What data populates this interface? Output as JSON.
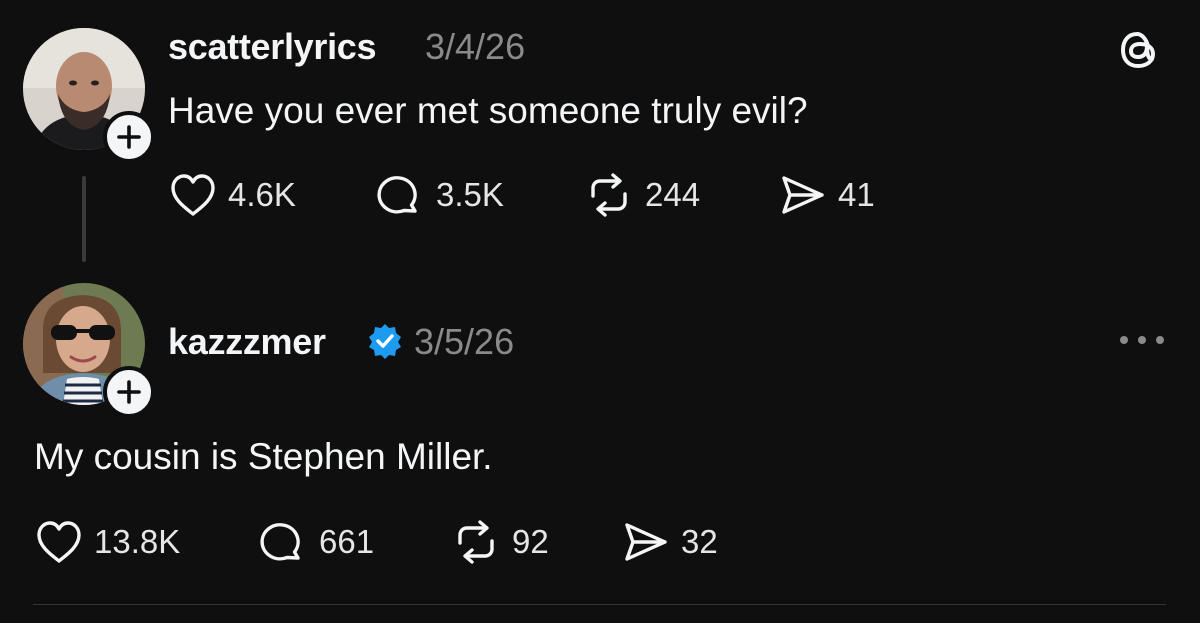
{
  "posts": [
    {
      "username": "scatterlyrics",
      "date": "3/4/26",
      "text": "Have you ever met someone truly evil?",
      "likes": "4.6K",
      "replies": "3.5K",
      "reposts": "244",
      "shares": "41"
    },
    {
      "username": "kazzzmer",
      "verified": true,
      "date": "3/5/26",
      "text": "My cousin is Stephen Miller.",
      "likes": "13.8K",
      "replies": "661",
      "reposts": "92",
      "shares": "32"
    }
  ],
  "icons": {
    "app_logo": "threads-logo-icon",
    "more": "more-options-icon",
    "follow": "plus-icon",
    "like": "heart-icon",
    "reply": "comment-icon",
    "repost": "repost-icon",
    "share": "send-icon",
    "verified": "verified-badge-icon"
  },
  "colors": {
    "background": "#0f0f0f",
    "text": "#f3f5f7",
    "muted": "#8a8a8a",
    "verified": "#1d9bf0"
  }
}
